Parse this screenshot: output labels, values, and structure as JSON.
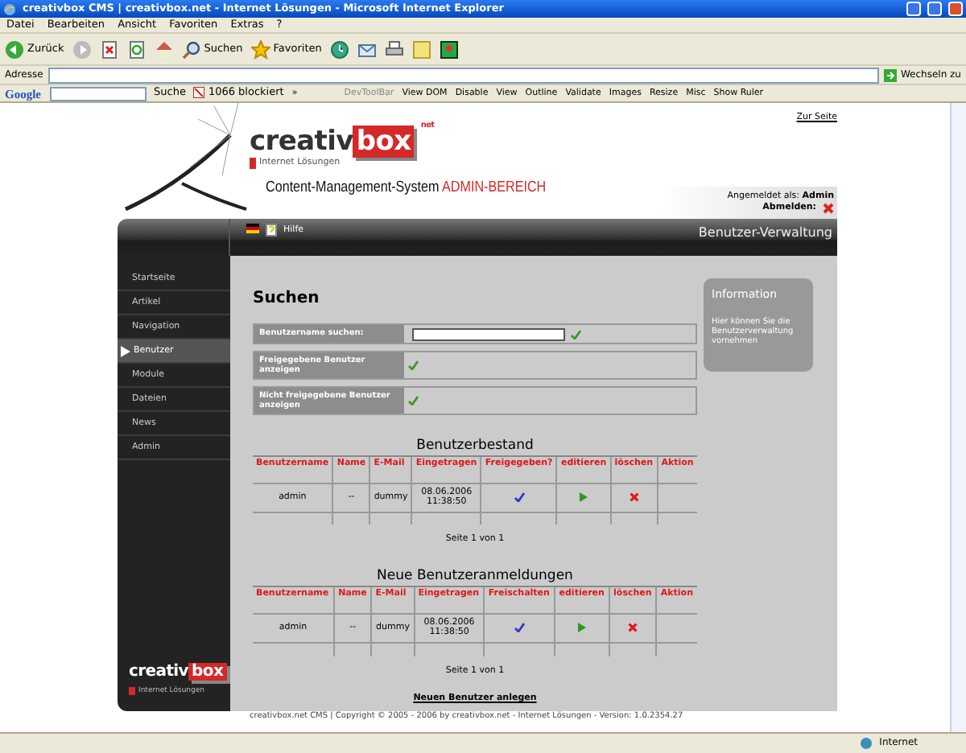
{
  "window": {
    "title": "creativbox CMS | creativbox.net - Internet Lösungen - Microsoft Internet Explorer"
  },
  "menu": [
    "Datei",
    "Bearbeiten",
    "Ansicht",
    "Favoriten",
    "Extras",
    "?"
  ],
  "toolbar": [
    {
      "kind": "back",
      "label": "Zurück"
    },
    {
      "kind": "forward"
    },
    {
      "kind": "stop"
    },
    {
      "kind": "refresh"
    },
    {
      "kind": "home"
    },
    {
      "kind": "search",
      "label": "Suchen"
    },
    {
      "kind": "favorites",
      "label": "Favoriten"
    },
    {
      "kind": "history"
    },
    {
      "kind": "mail"
    },
    {
      "kind": "print"
    },
    {
      "kind": "note"
    },
    {
      "kind": "messenger"
    }
  ],
  "address_bar": {
    "label": "Adresse",
    "go": "Wechseln zu"
  },
  "google_bar": {
    "logo": "Google",
    "search": "Suche",
    "blocked": "1066 blockiert",
    "more": "»",
    "devtoolbar": "DevToolBar",
    "items": [
      "View DOM",
      "Disable",
      "View",
      "Outline",
      "Validate",
      "Images",
      "Resize",
      "Misc",
      "Show Ruler"
    ]
  },
  "page": {
    "site_link": "Zur Seite",
    "logo": {
      "main": "creativ",
      "box": "box",
      "sup": "net",
      "sub": "Internet Lösungen"
    },
    "cms_title": "Content-Management-System",
    "cms_area": "ADMIN-BEREICH",
    "login_label": "Angemeldet als:",
    "login_user": "Admin",
    "logout": "Abmelden:",
    "help": "Hilfe",
    "section_title": "Benutzer-Verwaltung",
    "sidebar": [
      {
        "label": "Startseite",
        "selected": false
      },
      {
        "label": "Artikel",
        "selected": false
      },
      {
        "label": "Navigation",
        "selected": false
      },
      {
        "label": "Benutzer",
        "selected": true
      },
      {
        "label": "Module",
        "selected": false
      },
      {
        "label": "Dateien",
        "selected": false
      },
      {
        "label": "News",
        "selected": false
      },
      {
        "label": "Admin",
        "selected": false
      }
    ],
    "sidebar_logo": {
      "main": "creativ",
      "box": "box",
      "sub": "Internet Lösungen"
    },
    "search": {
      "title": "Suchen",
      "filters": [
        {
          "kind": "text",
          "label": "Benutzername suchen:"
        },
        {
          "kind": "toggle",
          "label": "Freigegebene Benutzer anzeigen"
        },
        {
          "kind": "toggle",
          "label": "Nicht freigegebene Benutzer anzeigen"
        }
      ]
    },
    "tables": [
      {
        "title": "Benutzerbestand",
        "columns": [
          "Benutzername",
          "Name",
          "E-Mail",
          "Eingetragen",
          "Freigegeben?",
          "editieren",
          "löschen",
          "Aktion"
        ],
        "rows": [
          {
            "username": "admin",
            "name": "--",
            "email": "dummy",
            "date": "08.06.2006",
            "time": "11:38:50",
            "approved": true
          }
        ],
        "pager": "Seite 1 von 1"
      },
      {
        "title": "Neue Benutzeranmeldungen",
        "columns": [
          "Benutzername",
          "Name",
          "E-Mail",
          "Eingetragen",
          "Freischalten",
          "editieren",
          "löschen",
          "Aktion"
        ],
        "rows": [
          {
            "username": "admin",
            "name": "--",
            "email": "dummy",
            "date": "08.06.2006",
            "time": "11:38:50",
            "approved": true
          }
        ],
        "pager": "Seite 1 von 1"
      }
    ],
    "add_user": "Neuen Benutzer anlegen",
    "info": {
      "title": "Information",
      "text": "Hier können Sie die Benutzerverwaltung vornehmen"
    },
    "footer": "creativbox.net CMS | Copyright © 2005 - 2006 by creativbox.net - Internet Lösungen - Version: 1.0.2354.27"
  },
  "status_bar": {
    "zone": "Internet"
  }
}
